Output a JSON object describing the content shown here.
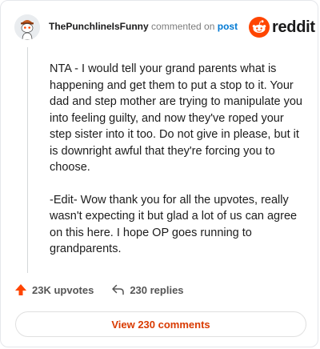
{
  "comment": {
    "username": "ThePunchlineIsFunny",
    "commented_text": "commented on",
    "post_link": "post",
    "brand": "reddit",
    "paragraphs": [
      "NTA - I would tell your grand parents what is happening and get them to put a stop to it. Your dad and step mother are trying to manipulate you into feeling guilty, and now they've roped your step sister into it too. Do not give in please, but it is downright awful that they're forcing you to choose.",
      "-Edit- Wow thank you for all the upvotes, really wasn't expecting it but glad a lot of us can agree on this here. I hope OP goes running to grandparents."
    ],
    "upvotes": "23K upvotes",
    "replies": "230 replies",
    "view_button": "View 230 comments"
  },
  "colors": {
    "brand_orange": "#ff4500",
    "link_blue": "#0079d3",
    "button_text": "#d93a00"
  },
  "icons": {
    "avatar": "snoo-avatar",
    "logo": "reddit-snoo-icon",
    "upvote": "upvote-arrow-icon",
    "reply": "reply-arrow-icon"
  }
}
